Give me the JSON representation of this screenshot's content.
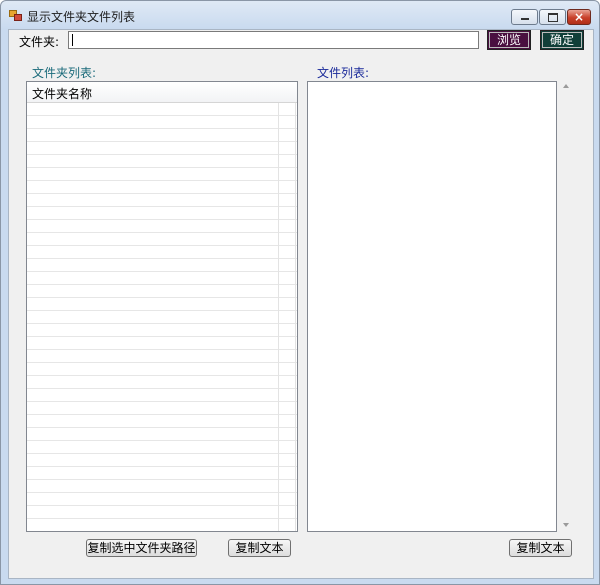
{
  "window": {
    "title": "显示文件夹文件列表",
    "minimize_icon": "minimize-icon",
    "maximize_icon": "maximize-icon",
    "close_icon": "close-icon",
    "close_glyph": "×"
  },
  "toolbar": {
    "folder_label": "文件夹:",
    "path_value": "",
    "browse_label": "浏览",
    "ok_label": "确定"
  },
  "folders": {
    "caption": "文件夹列表:",
    "columns": [
      "文件夹名称"
    ],
    "rows": []
  },
  "files": {
    "caption": "文件列表:",
    "items": []
  },
  "buttons": {
    "copy_path": "复制选中文件夹路径",
    "copy_text_left": "复制文本",
    "copy_text_right": "复制文本"
  },
  "colors": {
    "browse_bg": "#4a1040",
    "ok_bg": "#103f38",
    "folders_caption": "#1a6a7a",
    "files_caption": "#1a2a9a"
  }
}
